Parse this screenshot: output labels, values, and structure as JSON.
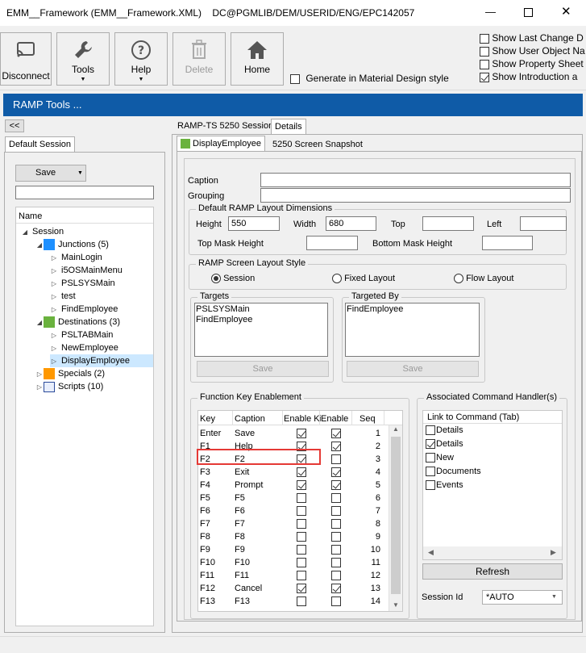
{
  "window": {
    "title": "EMM__Framework (EMM__Framework.XML)    DC@PGMLIB/DEM/USERID/ENG/EPC142057",
    "controls": [
      "—",
      "☐",
      "✕"
    ]
  },
  "toolbar": {
    "disconnect": "Disconnect",
    "tools": "Tools",
    "help": "Help",
    "delete": "Delete",
    "home": "Home",
    "generate_material": "Generate in Material Design style",
    "options": [
      {
        "label": "Show Last Change D",
        "checked": false
      },
      {
        "label": "Show User Object Na",
        "checked": false
      },
      {
        "label": "Show Property Sheet",
        "checked": false
      },
      {
        "label": "Show Introduction a",
        "checked": true
      }
    ]
  },
  "banner": {
    "title": "RAMP Tools ..."
  },
  "left": {
    "collapse": "<<",
    "session_tab": "Default Session",
    "save": "Save",
    "name_header": "Name",
    "tree": [
      {
        "label": "Session",
        "indent": 0,
        "toggle": "◢",
        "icon": ""
      },
      {
        "label": "Junctions (5)",
        "indent": 1,
        "toggle": "◢",
        "icon": "blue"
      },
      {
        "label": "MainLogin",
        "indent": 2,
        "toggle": "▷",
        "icon": ""
      },
      {
        "label": "i5OSMainMenu",
        "indent": 2,
        "toggle": "▷",
        "icon": ""
      },
      {
        "label": "PSLSYSMain",
        "indent": 2,
        "toggle": "▷",
        "icon": ""
      },
      {
        "label": "test",
        "indent": 2,
        "toggle": "▷",
        "icon": ""
      },
      {
        "label": "FindEmployee",
        "indent": 2,
        "toggle": "▷",
        "icon": ""
      },
      {
        "label": "Destinations (3)",
        "indent": 1,
        "toggle": "◢",
        "icon": "green"
      },
      {
        "label": "PSLTABMain",
        "indent": 2,
        "toggle": "▷",
        "icon": ""
      },
      {
        "label": "NewEmployee",
        "indent": 2,
        "toggle": "▷",
        "icon": ""
      },
      {
        "label": "DisplayEmployee",
        "indent": 2,
        "toggle": "▷",
        "icon": "",
        "selected": true
      },
      {
        "label": "Specials (2)",
        "indent": 1,
        "toggle": "▷",
        "icon": "orange"
      },
      {
        "label": "Scripts (10)",
        "indent": 1,
        "toggle": "▷",
        "icon": "script"
      }
    ]
  },
  "right": {
    "tabs": [
      "RAMP-TS 5250 Session",
      "Details"
    ],
    "subtabs": [
      "DisplayEmployee",
      "5250 Screen Snapshot"
    ],
    "caption_label": "Caption",
    "grouping_label": "Grouping",
    "layout_dims": {
      "title": "Default RAMP Layout Dimensions",
      "height_label": "Height",
      "height_value": "550",
      "width_label": "Width",
      "width_value": "680",
      "top_label": "Top",
      "left_label": "Left",
      "top_mask_label": "Top Mask Height",
      "bottom_mask_label": "Bottom Mask Height"
    },
    "layout_style": {
      "title": "RAMP Screen Layout Style",
      "options": [
        {
          "label": "Session",
          "selected": true
        },
        {
          "label": "Fixed Layout",
          "selected": false
        },
        {
          "label": "Flow Layout",
          "selected": false
        }
      ]
    },
    "targets": {
      "title": "Targets",
      "items": [
        "PSLSYSMain",
        "FindEmployee"
      ],
      "save": "Save"
    },
    "targeted_by": {
      "title": "Targeted By",
      "items": [
        "FindEmployee"
      ],
      "save": "Save"
    },
    "fkeys": {
      "title": "Function Key Enablement",
      "headers": [
        "Key",
        "Caption",
        "Enable Ki",
        "Enable",
        "Seq"
      ],
      "rows": [
        {
          "key": "Enter",
          "caption": "Save",
          "ek": true,
          "en": true,
          "seq": "1"
        },
        {
          "key": "F1",
          "caption": "Help",
          "ek": true,
          "en": true,
          "seq": "2"
        },
        {
          "key": "F2",
          "caption": "F2",
          "ek": true,
          "en": false,
          "seq": "3"
        },
        {
          "key": "F3",
          "caption": "Exit",
          "ek": true,
          "en": true,
          "seq": "4"
        },
        {
          "key": "F4",
          "caption": "Prompt",
          "ek": true,
          "en": true,
          "seq": "5"
        },
        {
          "key": "F5",
          "caption": "F5",
          "ek": false,
          "en": false,
          "seq": "6"
        },
        {
          "key": "F6",
          "caption": "F6",
          "ek": false,
          "en": false,
          "seq": "7"
        },
        {
          "key": "F7",
          "caption": "F7",
          "ek": false,
          "en": false,
          "seq": "8"
        },
        {
          "key": "F8",
          "caption": "F8",
          "ek": false,
          "en": false,
          "seq": "9"
        },
        {
          "key": "F9",
          "caption": "F9",
          "ek": false,
          "en": false,
          "seq": "10"
        },
        {
          "key": "F10",
          "caption": "F10",
          "ek": false,
          "en": false,
          "seq": "11"
        },
        {
          "key": "F11",
          "caption": "F11",
          "ek": false,
          "en": false,
          "seq": "12"
        },
        {
          "key": "F12",
          "caption": "Cancel",
          "ek": true,
          "en": true,
          "seq": "13"
        },
        {
          "key": "F13",
          "caption": "F13",
          "ek": false,
          "en": false,
          "seq": "14"
        }
      ]
    },
    "handlers": {
      "title": "Associated Command Handler(s)",
      "header": "Link to Command (Tab)",
      "items": [
        {
          "label": "Details",
          "checked": false
        },
        {
          "label": "Details",
          "checked": true
        },
        {
          "label": "New",
          "checked": false
        },
        {
          "label": "Documents",
          "checked": false
        },
        {
          "label": "Events",
          "checked": false
        }
      ],
      "refresh": "Refresh",
      "session_id_label": "Session Id",
      "session_id_value": "*AUTO"
    }
  },
  "colors": {
    "banner": "#0f5ba7",
    "highlight": "#e53935",
    "selected": "#cce8ff"
  }
}
